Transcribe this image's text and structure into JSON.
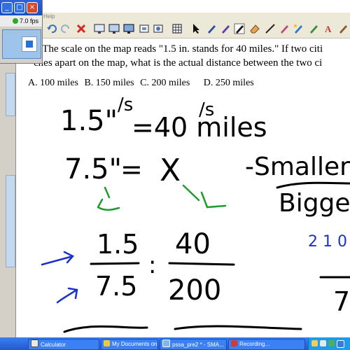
{
  "recorder": {
    "fps": "7.0 fps"
  },
  "menubar": {
    "help_label": "Help"
  },
  "question": {
    "line1": ".) The scale on the map reads \"1.5 in. stands for 40 miles.\" If two citi",
    "line2": "ches apart on the map, what is the actual distance between the two ci"
  },
  "choices": {
    "a": "A. 100 miles",
    "b": "B. 150 miles",
    "c": "C. 200 miles",
    "d": "D. 250 miles"
  },
  "handwriting": {
    "line1_left": "1.5\"",
    "line1_right": "=40 miles",
    "slash1": "/s",
    "slash2": "/s",
    "line2_left": "7.5\"",
    "line2_eq": "=",
    "line2_var": "X",
    "smaller": "-Smaller",
    "bigger": "Bigge",
    "num_left": "1.5",
    "den_left": "7.5",
    "num_right": "40",
    "den_right": "200",
    "colon": ":",
    "side_numbers": "2 1 0",
    "side_bottom": "7",
    "colors": {
      "ink": "#000000",
      "green": "#1f9b2e",
      "blue": "#1c33c8"
    }
  },
  "taskbar": {
    "items": [
      {
        "label": "Calculator",
        "icon": "calculator-icon"
      },
      {
        "label": "My Documents on '...",
        "icon": "folder-icon"
      },
      {
        "label": "pssa_pre2 * - SMA...",
        "icon": "smart-notebook-icon"
      },
      {
        "label": "Recording...",
        "icon": "recording-icon"
      }
    ]
  }
}
